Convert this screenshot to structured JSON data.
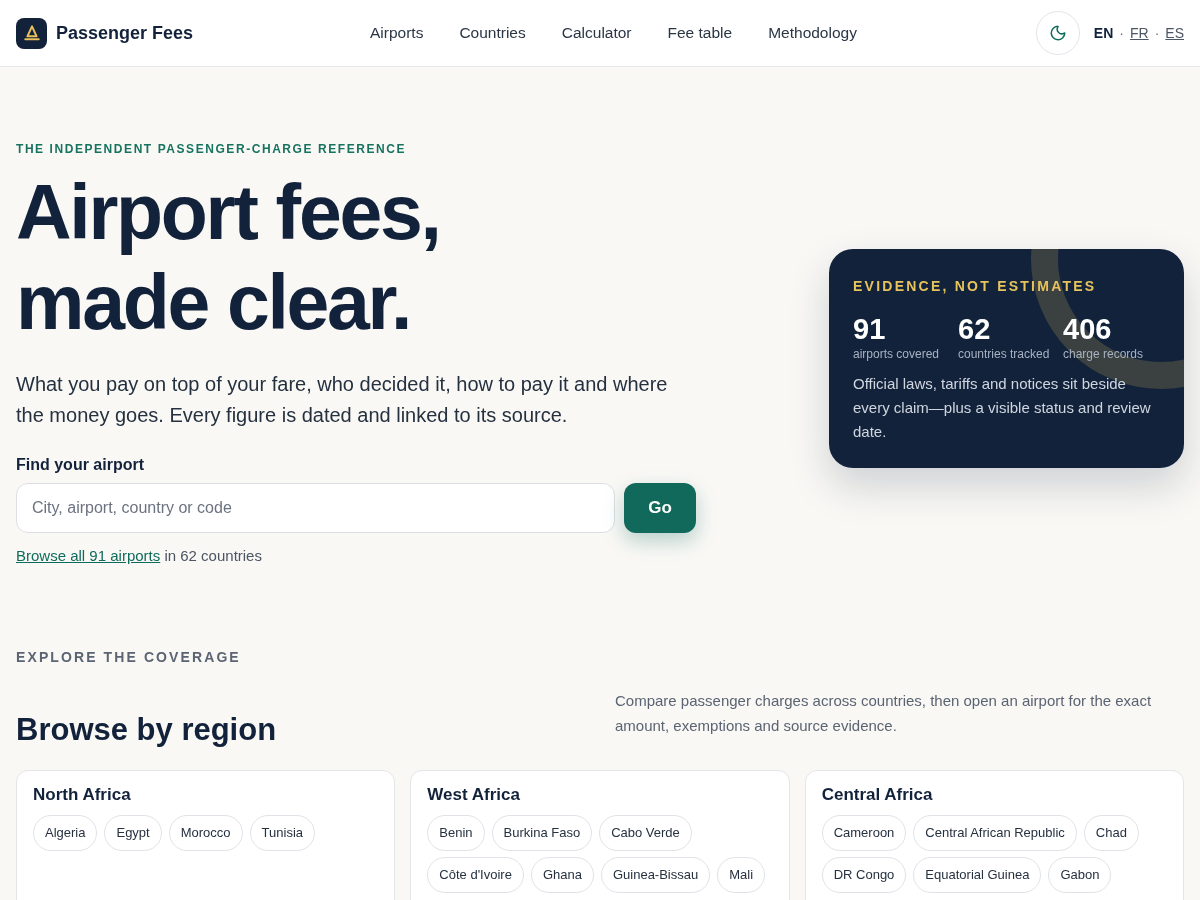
{
  "header": {
    "brand": "Passenger Fees",
    "nav": [
      "Airports",
      "Countries",
      "Calculator",
      "Fee table",
      "Methodology"
    ],
    "languages": [
      {
        "code": "EN",
        "selected": true
      },
      {
        "code": "FR",
        "selected": false
      },
      {
        "code": "ES",
        "selected": false
      }
    ],
    "language_separators": [
      "·",
      "·"
    ]
  },
  "hero": {
    "eyebrow": "THE INDEPENDENT PASSENGER-CHARGE REFERENCE",
    "title_lines": [
      "Airport fees,",
      "made clear."
    ],
    "lead": "What you pay on top of your fare, who decided it, how to pay it and where the money goes. Every figure is dated and linked to its source.",
    "search": {
      "label": "Find your airport",
      "placeholder": "City, airport, country or code",
      "button": "Go"
    },
    "browse": {
      "link": "Browse all 91 airports",
      "text": "in 62 countries"
    }
  },
  "evidence_card": {
    "eyebrow": "EVIDENCE, NOT ESTIMATES",
    "stats": [
      {
        "value": "91",
        "label": "airports covered"
      },
      {
        "value": "62",
        "label": "countries tracked"
      },
      {
        "value": "406",
        "label": "charge records"
      }
    ],
    "text": "Official laws, tariffs and notices sit beside every claim—plus a visible status and review date."
  },
  "coverage": {
    "eyebrow": "EXPLORE THE COVERAGE",
    "title": "Browse by region",
    "description": "Compare passenger charges across countries, then open an airport for the exact amount, exemptions and source evidence.",
    "regions": [
      {
        "name": "North Africa",
        "countries": [
          "Algeria",
          "Egypt",
          "Morocco",
          "Tunisia"
        ]
      },
      {
        "name": "West Africa",
        "countries": [
          "Benin",
          "Burkina Faso",
          "Cabo Verde",
          "Côte d'Ivoire",
          "Ghana",
          "Guinea-Bissau",
          "Mali"
        ]
      },
      {
        "name": "Central Africa",
        "countries": [
          "Cameroon",
          "Central African Republic",
          "Chad",
          "DR Congo",
          "Equatorial Guinea",
          "Gabon"
        ]
      }
    ]
  }
}
